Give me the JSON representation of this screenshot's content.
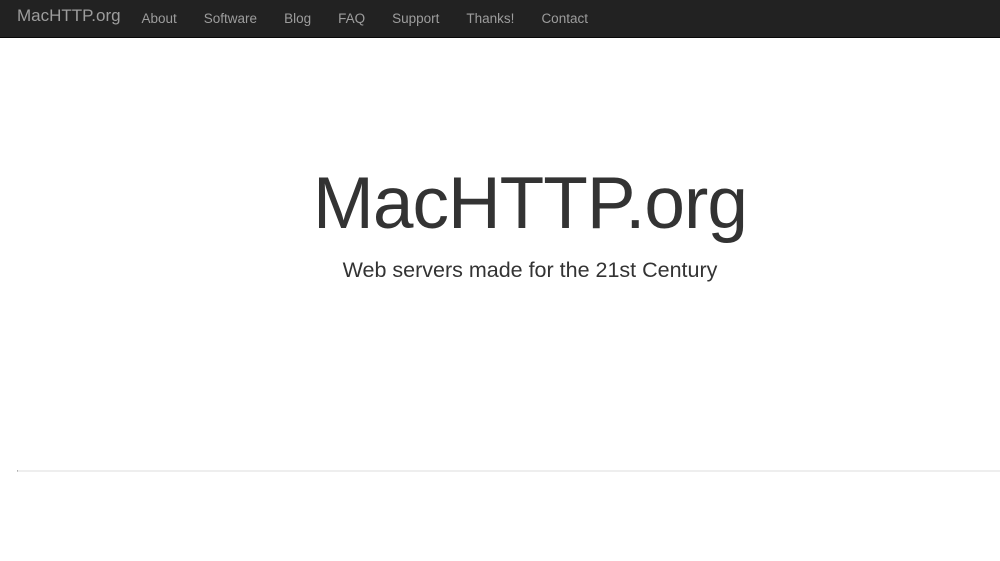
{
  "navbar": {
    "brand": "MacHTTP.org",
    "items": [
      {
        "label": "About"
      },
      {
        "label": "Software"
      },
      {
        "label": "Blog"
      },
      {
        "label": "FAQ"
      },
      {
        "label": "Support"
      },
      {
        "label": "Thanks!"
      },
      {
        "label": "Contact"
      }
    ]
  },
  "hero": {
    "title": "MacHTTP.org",
    "subtitle": "Web servers made for the 21st Century"
  },
  "colors": {
    "navbar_bg": "#222222",
    "nav_text": "#9d9d9d",
    "body_text": "#333333",
    "divider": "#eeeeee"
  }
}
